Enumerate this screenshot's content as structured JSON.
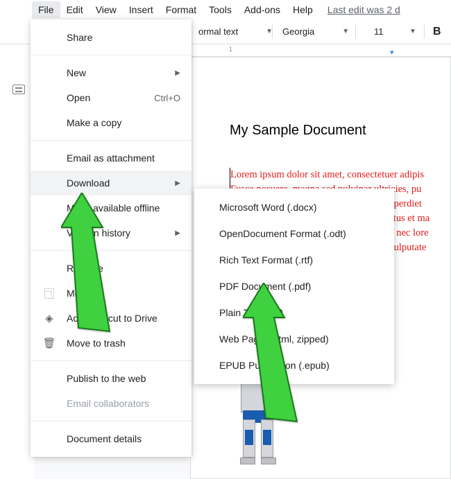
{
  "menubar": {
    "items": [
      "File",
      "Edit",
      "View",
      "Insert",
      "Format",
      "Tools",
      "Add-ons",
      "Help"
    ],
    "last_edit": "Last edit was 2 d"
  },
  "toolbar": {
    "style": "ormal text",
    "font": "Georgia",
    "size": "11",
    "bold": "B"
  },
  "document": {
    "title": "My Sample Document",
    "body": "Lorem ipsum dolor sit amet, consectetuer adipis\nFusce posuere, magna sed pulvinar ultricies, pu\n                                                               nperdiet\n                                                               etus et ma\n                                                               n nec lore\n                                                               vulputate"
  },
  "file_menu": {
    "share": "Share",
    "new": "New",
    "open": "Open",
    "open_shortcut": "Ctrl+O",
    "make_copy": "Make a copy",
    "email": "Email as attachment",
    "download": "Download",
    "offline": "Make available offline",
    "version": "Version history",
    "rename": "Rename",
    "move": "Move",
    "add_shortcut": "Add shortcut to Drive",
    "trash": "Move to trash",
    "publish": "Publish to the web",
    "email_collab": "Email collaborators",
    "doc_details": "Document details"
  },
  "download_submenu": {
    "items": [
      "Microsoft Word (.docx)",
      "OpenDocument Format (.odt)",
      "Rich Text Format (.rtf)",
      "PDF Document (.pdf)",
      "Plain Text (.txt)",
      "Web Page (.html, zipped)",
      "EPUB Publication (.epub)"
    ]
  }
}
